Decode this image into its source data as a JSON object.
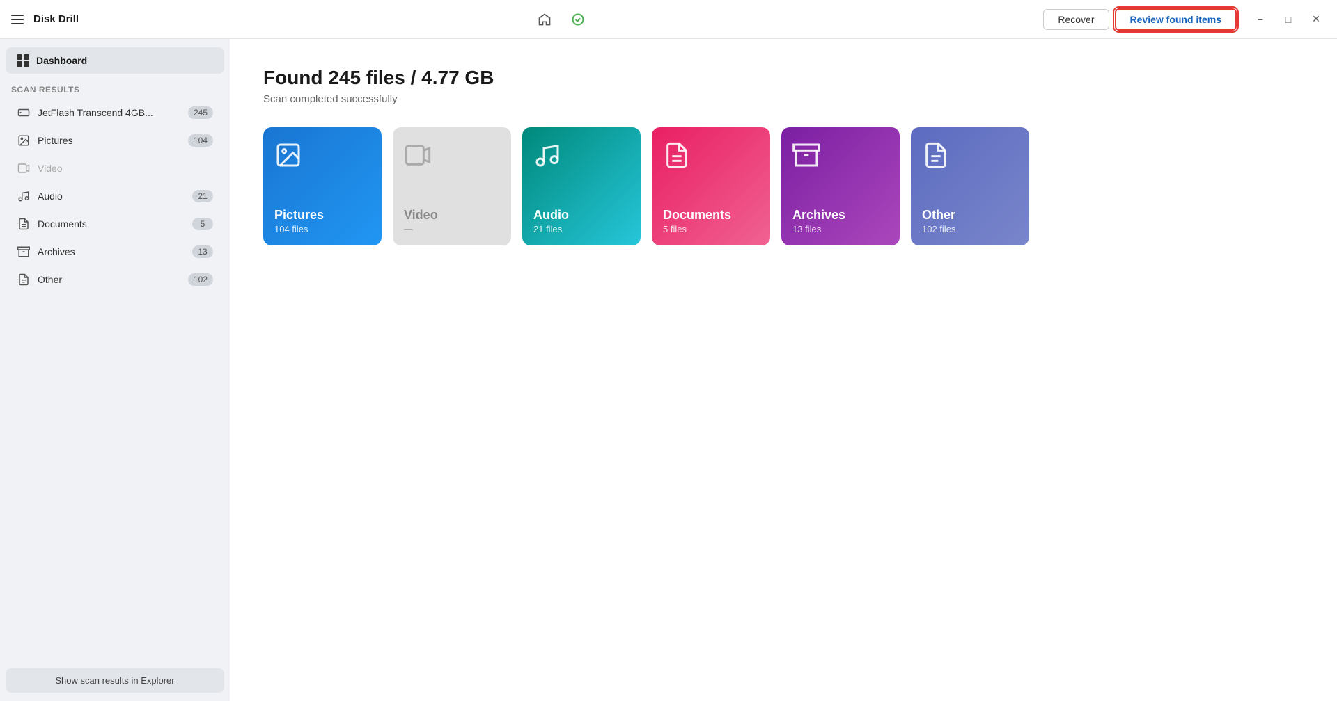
{
  "app": {
    "title": "Disk Drill",
    "hamburger_label": "menu"
  },
  "titlebar": {
    "recover_label": "Recover",
    "review_label": "Review found items",
    "minimize_label": "−",
    "maximize_label": "□",
    "close_label": "✕"
  },
  "sidebar": {
    "dashboard_label": "Dashboard",
    "scan_results_label": "Scan results",
    "items": [
      {
        "id": "jetflash",
        "label": "JetFlash Transcend 4GB...",
        "count": "245",
        "icon": "drive"
      },
      {
        "id": "pictures",
        "label": "Pictures",
        "count": "104",
        "icon": "pictures"
      },
      {
        "id": "video",
        "label": "Video",
        "count": "",
        "icon": "video",
        "dimmed": true
      },
      {
        "id": "audio",
        "label": "Audio",
        "count": "21",
        "icon": "audio"
      },
      {
        "id": "documents",
        "label": "Documents",
        "count": "5",
        "icon": "documents"
      },
      {
        "id": "archives",
        "label": "Archives",
        "count": "13",
        "icon": "archives"
      },
      {
        "id": "other",
        "label": "Other",
        "count": "102",
        "icon": "other"
      }
    ],
    "footer_btn": "Show scan results in Explorer"
  },
  "main": {
    "found_title": "Found 245 files / 4.77 GB",
    "scan_status": "Scan completed successfully",
    "cards": [
      {
        "id": "pictures",
        "name": "Pictures",
        "count": "104 files",
        "icon": "🖼",
        "style": "pictures"
      },
      {
        "id": "video",
        "name": "Video",
        "count": "—",
        "icon": "🎬",
        "style": "video"
      },
      {
        "id": "audio",
        "name": "Audio",
        "count": "21 files",
        "icon": "🎵",
        "style": "audio"
      },
      {
        "id": "documents",
        "name": "Documents",
        "count": "5 files",
        "icon": "📄",
        "style": "documents"
      },
      {
        "id": "archives",
        "name": "Archives",
        "count": "13 files",
        "icon": "🗜",
        "style": "archives"
      },
      {
        "id": "other",
        "name": "Other",
        "count": "102 files",
        "icon": "📋",
        "style": "other"
      }
    ]
  }
}
